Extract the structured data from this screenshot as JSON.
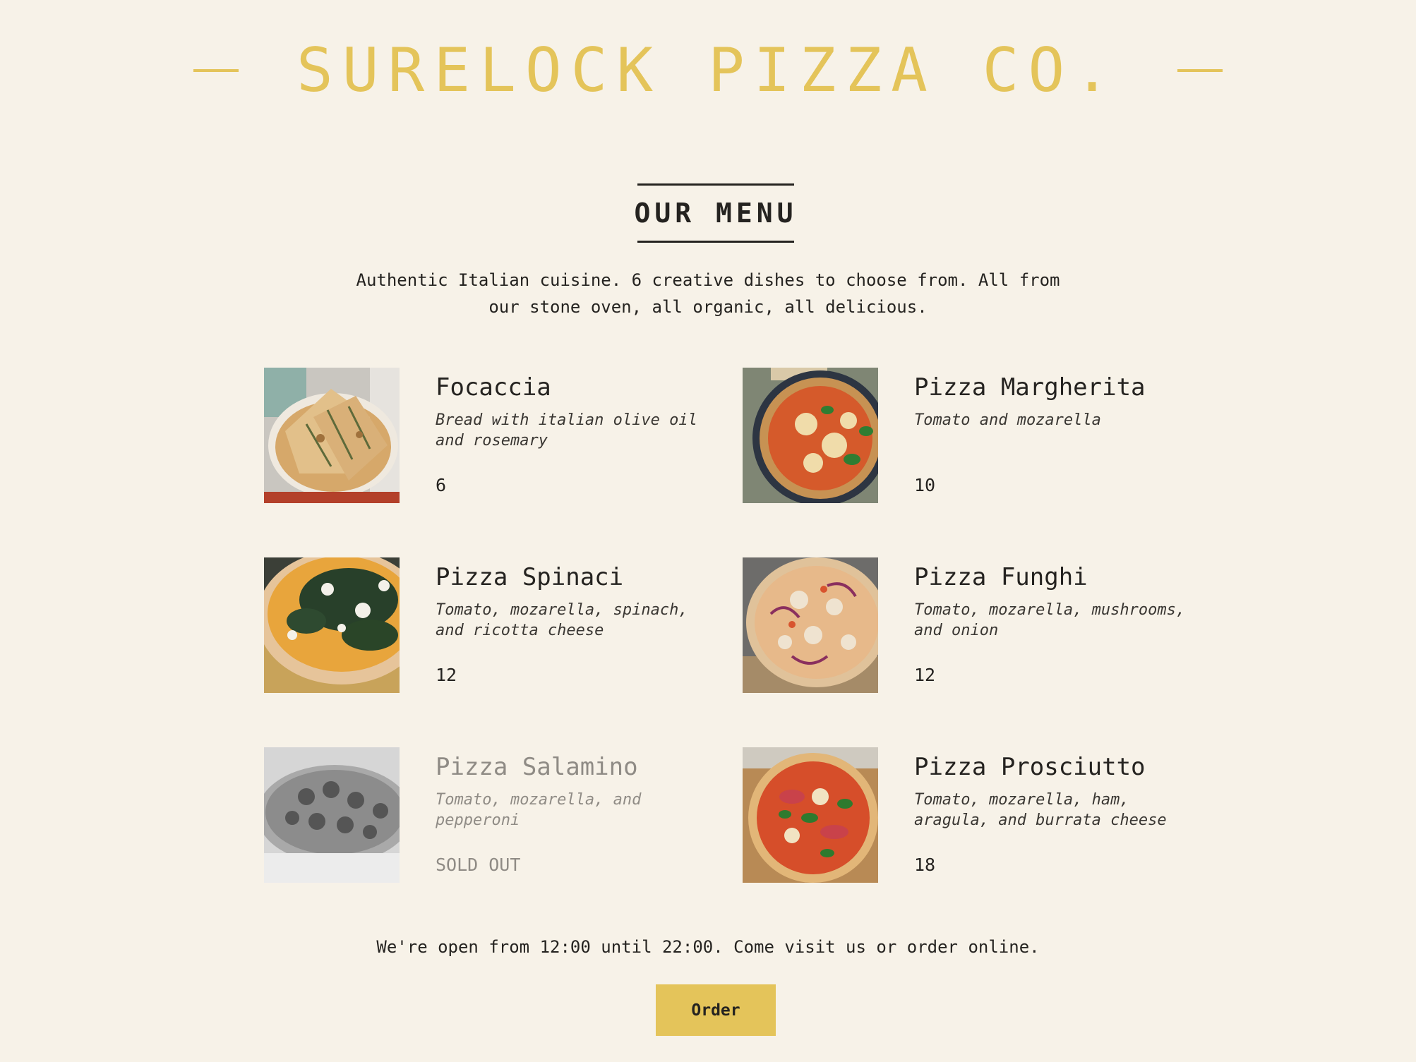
{
  "header": {
    "brand": "SURELOCK PIZZA CO."
  },
  "menu_section": {
    "title": "OUR MENU",
    "intro": "Authentic Italian cuisine. 6 creative dishes to choose from. All from our stone oven, all organic, all delicious."
  },
  "menu_items": [
    {
      "name": "Focaccia",
      "description": "Bread with italian olive oil and rosemary",
      "price": "6",
      "sold_out": false
    },
    {
      "name": "Pizza Margherita",
      "description": "Tomato and mozarella",
      "price": "10",
      "sold_out": false
    },
    {
      "name": "Pizza Spinaci",
      "description": "Tomato, mozarella, spinach, and ricotta cheese",
      "price": "12",
      "sold_out": false
    },
    {
      "name": "Pizza Funghi",
      "description": "Tomato, mozarella, mushrooms, and onion",
      "price": "12",
      "sold_out": false
    },
    {
      "name": "Pizza Salamino",
      "description": "Tomato, mozarella, and pepperoni",
      "price": "SOLD OUT",
      "sold_out": true
    },
    {
      "name": "Pizza Prosciutto",
      "description": "Tomato, mozarella, ham, aragula, and burrata cheese",
      "price": "18",
      "sold_out": false
    }
  ],
  "footer": {
    "hours_text": "We're open from 12:00 until 22:00. Come visit us or order online.",
    "order_label": "Order"
  },
  "colors": {
    "background": "#f7f2e8",
    "accent": "#e4c45a",
    "text": "#252320",
    "muted": "#8f8b85"
  }
}
